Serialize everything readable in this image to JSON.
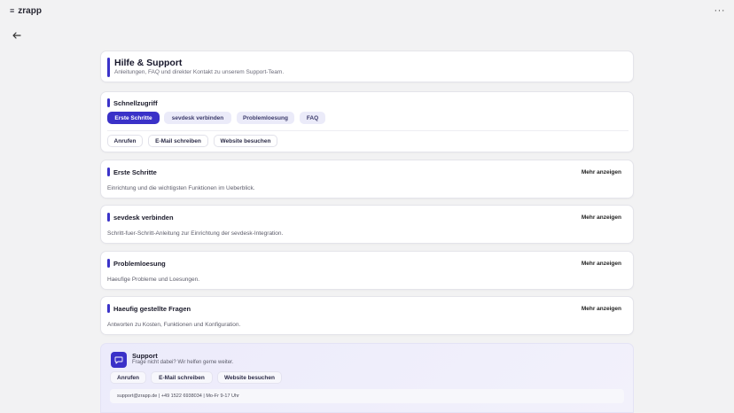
{
  "app": {
    "name": "zrapp",
    "logo_glyph": "≡",
    "more_glyph": "···"
  },
  "header": {
    "title": "Hilfe & Support",
    "subtitle": "Anleitungen, FAQ und direkter Kontakt zu unserem Support-Team."
  },
  "quick_access": {
    "title": "Schnellzugriff",
    "chips": [
      "Erste Schritte",
      "sevdesk verbinden",
      "Problemloesung",
      "FAQ"
    ],
    "actions": [
      "Anrufen",
      "E-Mail schreiben",
      "Website besuchen"
    ]
  },
  "sections": [
    {
      "title": "Erste Schritte",
      "desc": "Einrichtung und die wichtigsten Funktionen im Ueberblick.",
      "more": "Mehr anzeigen"
    },
    {
      "title": "sevdesk verbinden",
      "desc": "Schritt-fuer-Schritt-Anleitung zur Einrichtung der sevdesk-Integration.",
      "more": "Mehr anzeigen"
    },
    {
      "title": "Problemloesung",
      "desc": "Haeufige Probleme und Loesungen.",
      "more": "Mehr anzeigen"
    },
    {
      "title": "Haeufig gestellte Fragen",
      "desc": "Antworten zu Kosten, Funktionen und Konfiguration.",
      "more": "Mehr anzeigen"
    }
  ],
  "support": {
    "title": "Support",
    "subtitle": "Frage nicht dabei? Wir helfen gerne weiter.",
    "actions": [
      "Anrufen",
      "E-Mail schreiben",
      "Website besuchen"
    ],
    "contact": "support@zrapp.de | +49 1522 6938034 | Mo-Fr 9-17 Uhr"
  },
  "colors": {
    "accent": "#3a31c8",
    "background": "#f2f2f3",
    "chip_soft": "#ebebf9"
  }
}
